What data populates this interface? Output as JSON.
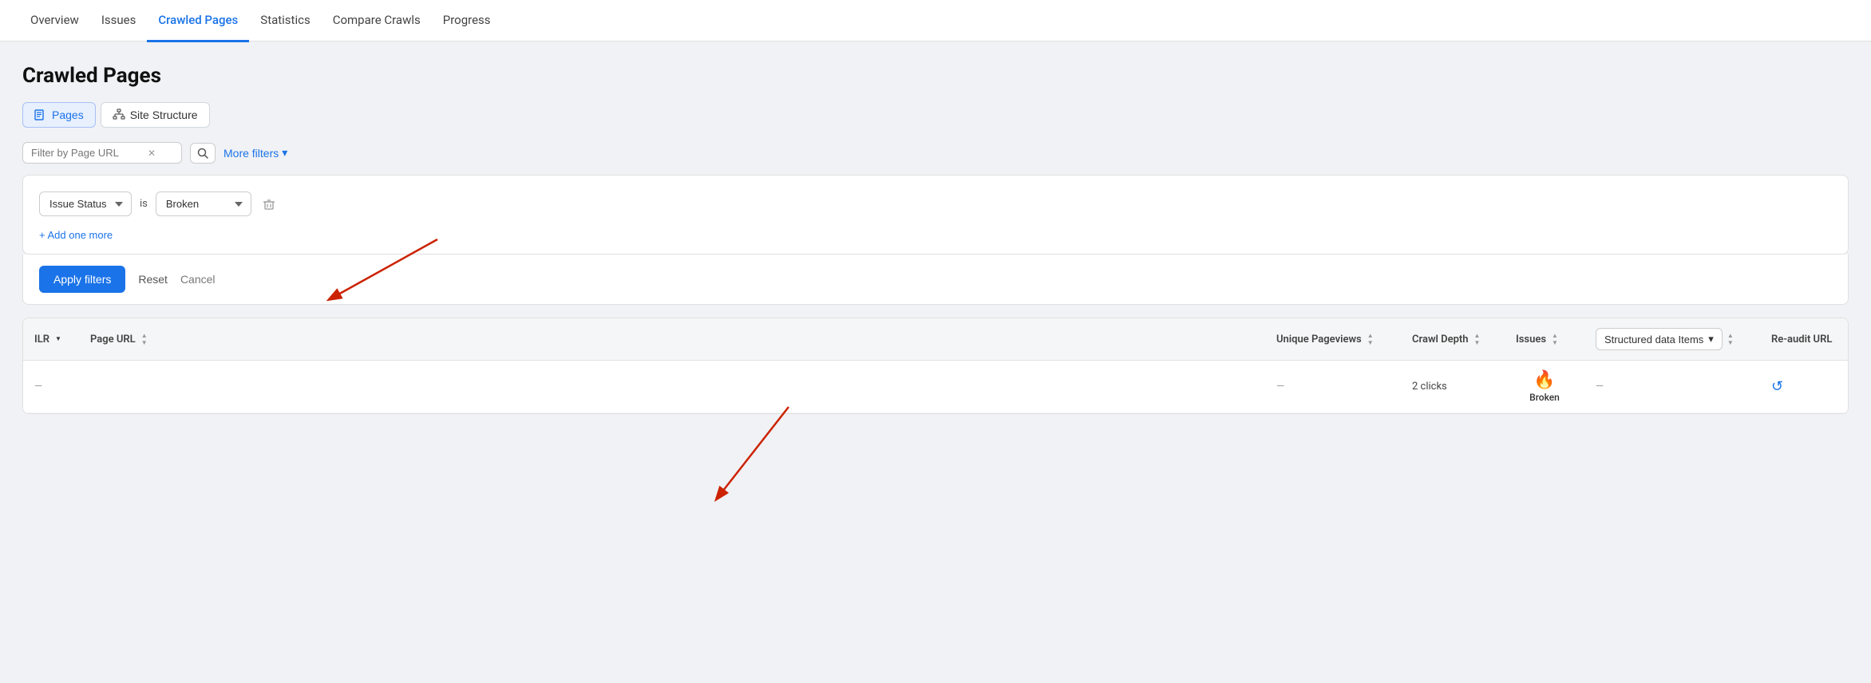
{
  "nav": {
    "items": [
      {
        "label": "Overview",
        "active": false
      },
      {
        "label": "Issues",
        "active": false
      },
      {
        "label": "Crawled Pages",
        "active": true
      },
      {
        "label": "Statistics",
        "active": false
      },
      {
        "label": "Compare Crawls",
        "active": false
      },
      {
        "label": "Progress",
        "active": false
      }
    ]
  },
  "page": {
    "title": "Crawled Pages"
  },
  "tabs": [
    {
      "label": "Pages",
      "active": true,
      "icon": "pages-icon"
    },
    {
      "label": "Site Structure",
      "active": false,
      "icon": "site-structure-icon"
    }
  ],
  "filter_bar": {
    "url_placeholder": "Filter by Page URL",
    "more_filters_label": "More filters"
  },
  "filter_panel": {
    "filter_type_value": "Issue Status",
    "filter_operator": "is",
    "filter_value": "Broken",
    "add_more_label": "+ Add one more"
  },
  "filter_actions": {
    "apply_label": "Apply filters",
    "reset_label": "Reset",
    "cancel_label": "Cancel"
  },
  "table": {
    "columns": [
      {
        "label": "ILR",
        "sortable": true
      },
      {
        "label": "Page URL",
        "sortable": true
      },
      {
        "label": "Unique Pageviews",
        "sortable": true
      },
      {
        "label": "Crawl Depth",
        "sortable": true
      },
      {
        "label": "Issues",
        "sortable": true
      },
      {
        "label": "Structured data Items",
        "sortable": true,
        "dropdown": true
      },
      {
        "label": "Re-audit URL",
        "sortable": false
      }
    ],
    "rows": [
      {
        "ilr": "—",
        "url": "",
        "pageviews": "—",
        "depth": "2 clicks",
        "issues_icon": "🔥",
        "issues_label": "Broken",
        "structured": "—",
        "reaudit": "↺"
      }
    ]
  }
}
